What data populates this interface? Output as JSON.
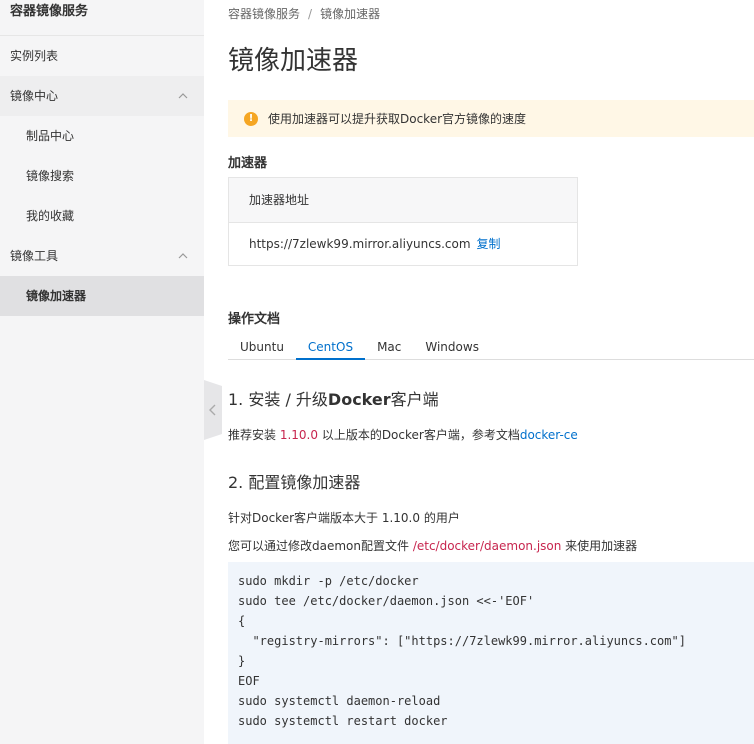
{
  "sidebar": {
    "title": "容器镜像服务",
    "items": [
      {
        "label": "实例列表"
      },
      {
        "label": "镜像中心"
      },
      {
        "label": "制品中心"
      },
      {
        "label": "镜像搜索"
      },
      {
        "label": "我的收藏"
      },
      {
        "label": "镜像工具"
      },
      {
        "label": "镜像加速器"
      }
    ]
  },
  "breadcrumb": {
    "root": "容器镜像服务",
    "sep": "/",
    "current": "镜像加速器"
  },
  "page_title": "镜像加速器",
  "alert": {
    "icon": "!",
    "text": "使用加速器可以提升获取Docker官方镜像的速度"
  },
  "accelerator": {
    "section_title": "加速器",
    "header": "加速器地址",
    "address": "https://7zlewk99.mirror.aliyuncs.com",
    "copy_label": "复制"
  },
  "docs": {
    "section_title": "操作文档",
    "tabs": [
      {
        "label": "Ubuntu"
      },
      {
        "label": "CentOS"
      },
      {
        "label": "Mac"
      },
      {
        "label": "Windows"
      }
    ],
    "step1": {
      "prefix": "1. 安装 / 升级",
      "bold": "Docker",
      "suffix": "客户端",
      "para_pre": "推荐安装 ",
      "version": "1.10.0",
      "para_mid": " 以上版本的Docker客户端，参考文档",
      "link": "docker-ce"
    },
    "step2": {
      "title": "2. 配置镜像加速器",
      "para1": "针对Docker客户端版本大于 1.10.0 的用户",
      "para2_pre": "您可以通过修改daemon配置文件 ",
      "path": "/etc/docker/daemon.json",
      "para2_post": " 来使用加速器"
    },
    "code_lines": [
      "sudo mkdir -p /etc/docker",
      "sudo tee /etc/docker/daemon.json <<-'EOF'",
      "{",
      "  \"registry-mirrors\": [\"https://7zlewk99.mirror.aliyuncs.com\"]",
      "}",
      "EOF",
      "sudo systemctl daemon-reload",
      "sudo systemctl restart docker"
    ]
  }
}
